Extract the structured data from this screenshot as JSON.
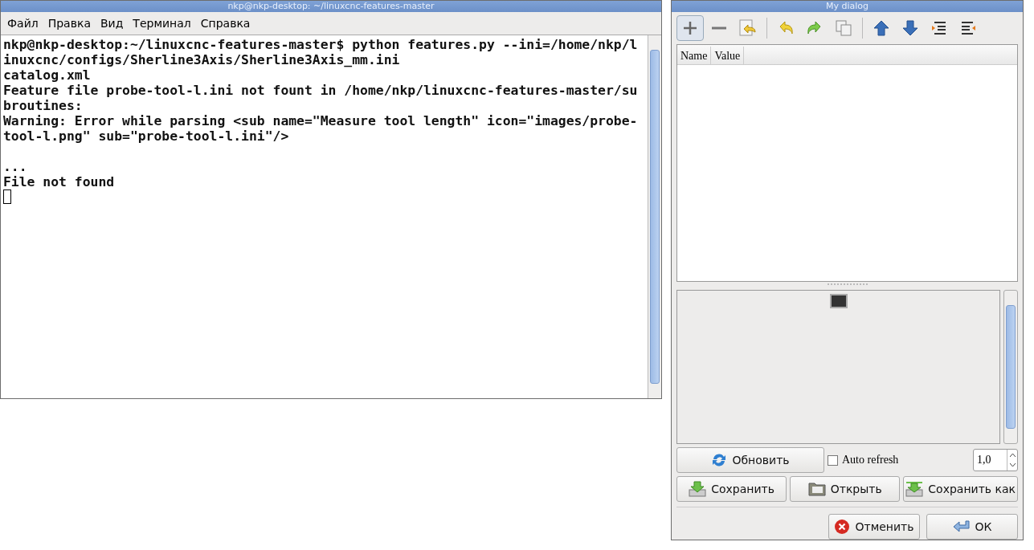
{
  "terminal": {
    "title": "nkp@nkp-desktop: ~/linuxcnc-features-master",
    "menu": [
      "Файл",
      "Правка",
      "Вид",
      "Терминал",
      "Справка"
    ],
    "lines": [
      "nkp@nkp-desktop:~/linuxcnc-features-master$ python features.py --ini=/home/nkp/l",
      "inuxcnc/configs/Sherline3Axis/Sherline3Axis_mm.ini",
      "catalog.xml",
      "Feature file probe-tool-l.ini not fount in /home/nkp/linuxcnc-features-master/su",
      "broutines:",
      "Warning: Error while parsing <sub name=\"Measure tool length\" icon=\"images/probe-",
      "tool-l.png\" sub=\"probe-tool-l.ini\"/>",
      "...",
      "File not found"
    ]
  },
  "dialog": {
    "title": "My dialog",
    "toolbar": [
      {
        "kind": "add",
        "pressed": true
      },
      {
        "kind": "remove",
        "pressed": false
      },
      {
        "kind": "paste",
        "pressed": false
      },
      {
        "kind": "separator"
      },
      {
        "kind": "undo",
        "pressed": false
      },
      {
        "kind": "redo",
        "pressed": false
      },
      {
        "kind": "copy",
        "pressed": false
      },
      {
        "kind": "separator"
      },
      {
        "kind": "up",
        "pressed": false
      },
      {
        "kind": "down",
        "pressed": false
      },
      {
        "kind": "indent",
        "pressed": false
      },
      {
        "kind": "unindent",
        "pressed": false
      }
    ],
    "table": {
      "columns": [
        "Name",
        "Value"
      ]
    },
    "refresh_button": "Обновить",
    "auto_refresh": {
      "label": "Auto refresh",
      "checked": false
    },
    "interval": "1,0",
    "file_buttons": [
      {
        "kind": "save",
        "label": "Сохранить"
      },
      {
        "kind": "open",
        "label": "Открыть"
      },
      {
        "kind": "saveas",
        "label": "Сохранить как"
      }
    ],
    "buttons": [
      {
        "kind": "cancel",
        "label": "Отменить"
      },
      {
        "kind": "ok",
        "label": "ОК"
      }
    ]
  }
}
